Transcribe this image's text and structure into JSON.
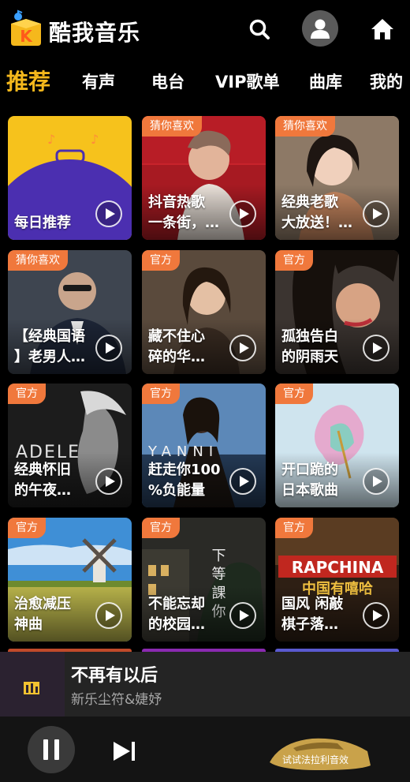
{
  "app": {
    "title": "酷我音乐",
    "logo_letter": "K"
  },
  "tabs": [
    "推荐",
    "有声",
    "电台",
    "VIP歌单",
    "曲库",
    "我的"
  ],
  "cards": [
    {
      "badge": "",
      "label": "每日推荐"
    },
    {
      "badge": "猜你喜欢",
      "label": "抖音热歌\n一条街，…"
    },
    {
      "badge": "猜你喜欢",
      "label": "经典老歌\n大放送！…"
    },
    {
      "badge": "猜你喜欢",
      "label": "【经典国语\n】老男人…"
    },
    {
      "badge": "官方",
      "label": "藏不住心\n碎的华…"
    },
    {
      "badge": "官方",
      "label": "孤独告白\n的阴雨天"
    },
    {
      "badge": "官方",
      "label": "经典怀旧\n的午夜…"
    },
    {
      "badge": "官方",
      "label": "赶走你100\n%负能量"
    },
    {
      "badge": "官方",
      "label": "开口跪的\n日本歌曲"
    },
    {
      "badge": "官方",
      "label": "治愈减压\n神曲"
    },
    {
      "badge": "官方",
      "label": "不能忘却\n的校园…"
    },
    {
      "badge": "官方",
      "label": "国风 闲敲\n棋子落…"
    }
  ],
  "art_text": {
    "adele": "ADELE",
    "yanni": "YANNI",
    "rap_top": "RAPCHINA",
    "rap_bottom": "中国有嘻哈",
    "poster": "下 等 課 你"
  },
  "player": {
    "title": "不再有以后",
    "artist": "新乐尘符&婕妤"
  },
  "promo": {
    "label": "试试法拉利音效"
  },
  "colors": {
    "accent": "#f5b81c",
    "badge": "#f0783c"
  }
}
